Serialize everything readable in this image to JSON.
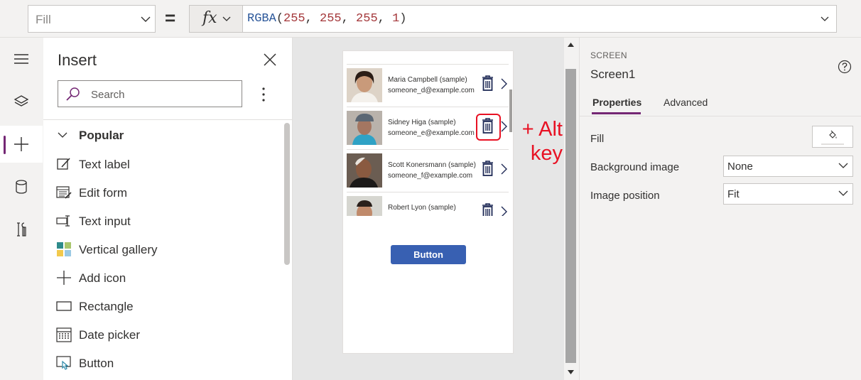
{
  "formula_bar": {
    "property": "Fill",
    "equals": "=",
    "fx_label": "fx",
    "formula": {
      "fn": "RGBA",
      "open": "(",
      "a": "255",
      "b": "255",
      "c": "255",
      "d": "1",
      "sep": ", ",
      "close": ")"
    }
  },
  "left_rail": {
    "items": [
      "menu-icon",
      "layers-icon",
      "insert-plus-icon",
      "database-icon",
      "tools-icon"
    ]
  },
  "insert_pane": {
    "title": "Insert",
    "search_placeholder": "Search",
    "popular_label": "Popular",
    "items": [
      {
        "label": "Text label",
        "icon": "text-label-icon"
      },
      {
        "label": "Edit form",
        "icon": "edit-form-icon"
      },
      {
        "label": "Text input",
        "icon": "text-input-icon"
      },
      {
        "label": "Vertical gallery",
        "icon": "gallery-icon"
      },
      {
        "label": "Add icon",
        "icon": "add-icon"
      },
      {
        "label": "Rectangle",
        "icon": "rectangle-icon"
      },
      {
        "label": "Date picker",
        "icon": "calendar-icon"
      },
      {
        "label": "Button",
        "icon": "button-icon"
      }
    ]
  },
  "canvas": {
    "gallery": [
      {
        "name": "Maria Campbell (sample)",
        "email": "someone_d@example.com"
      },
      {
        "name": "Sidney Higa (sample)",
        "email": "someone_e@example.com"
      },
      {
        "name": "Scott Konersmann (sample)",
        "email": "someone_f@example.com"
      },
      {
        "name": "Robert Lyon (sample)",
        "email": ""
      }
    ],
    "button_label": "Button",
    "annotation_line1": "+ Alt",
    "annotation_line2": "key",
    "annotation_color": "#e81123",
    "button_color": "#3860b2"
  },
  "properties_pane": {
    "kind": "SCREEN",
    "name": "Screen1",
    "tabs": [
      "Properties",
      "Advanced"
    ],
    "active_tab": "Properties",
    "fill_label": "Fill",
    "background_image_label": "Background image",
    "background_image_value": "None",
    "image_position_label": "Image position",
    "image_position_value": "Fit",
    "accent_color": "#742774"
  }
}
